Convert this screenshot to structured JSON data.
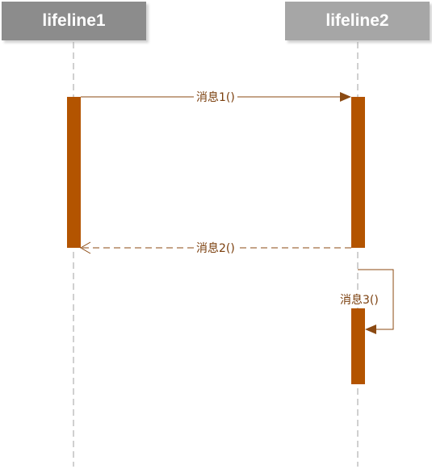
{
  "lifelines": [
    {
      "name": "lifeline1"
    },
    {
      "name": "lifeline2"
    }
  ],
  "messages": [
    {
      "label": "消息1()",
      "type": "sync",
      "from": "lifeline1",
      "to": "lifeline2"
    },
    {
      "label": "消息2()",
      "type": "reply",
      "from": "lifeline2",
      "to": "lifeline1"
    },
    {
      "label": "消息3()",
      "type": "self",
      "from": "lifeline2",
      "to": "lifeline2"
    }
  ],
  "colors": {
    "activation": "#b35400",
    "message_line": "#8b4a12",
    "label_text": "#7a3e0c",
    "lifeline_line": "#a0a0a0"
  }
}
